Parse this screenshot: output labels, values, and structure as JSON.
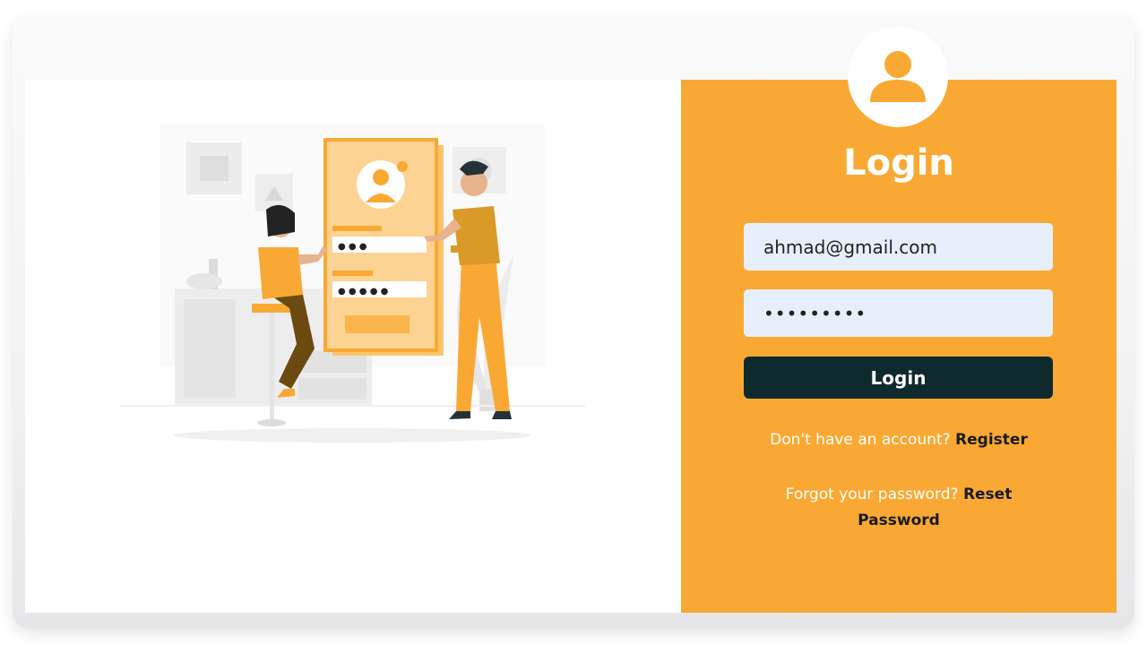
{
  "login": {
    "title": "Login",
    "email_value": "ahmad@gmail.com",
    "password_value": "•••••••••",
    "button_label": "Login",
    "register_prompt": "Don't have an account?",
    "register_link": "Register",
    "forgot_prompt": "Forgot your password?",
    "reset_link": "Reset Password"
  },
  "illustration": {
    "password_dots_1": "● ● ●",
    "password_dots_2": "● ● ● ● ●"
  },
  "colors": {
    "accent": "#f9a933",
    "button": "#0f2a2d",
    "input_bg": "#e8effc"
  },
  "icons": {
    "avatar": "user-icon"
  }
}
